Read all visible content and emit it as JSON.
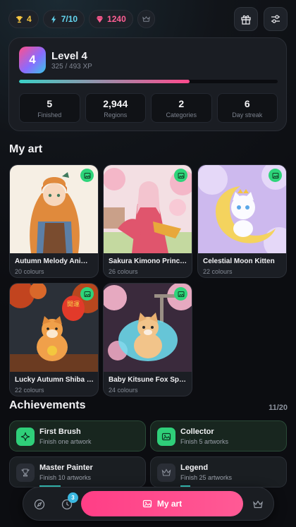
{
  "header": {
    "chips": [
      {
        "icon": "trophy-icon",
        "value": "4"
      },
      {
        "icon": "bolt-icon",
        "value": "7/10"
      },
      {
        "icon": "gem-icon",
        "value": "1240"
      },
      {
        "icon": "crown-icon",
        "value": ""
      }
    ],
    "buttons": [
      {
        "icon": "gift-icon"
      },
      {
        "icon": "sliders-icon"
      }
    ]
  },
  "level": {
    "badge": "4",
    "title": "Level 4",
    "xp": "325 / 493 XP",
    "progress_fraction": 0.66,
    "stats": [
      {
        "value": "5",
        "label": "Finished"
      },
      {
        "value": "2,944",
        "label": "Regions"
      },
      {
        "value": "2",
        "label": "Categories"
      },
      {
        "value": "6",
        "label": "Day streak"
      }
    ]
  },
  "my_art": {
    "title": "My art",
    "items": [
      {
        "name": "Autumn Melody Anime ...",
        "sub": "20 colours"
      },
      {
        "name": "Sakura Kimono Princess",
        "sub": "26 colours"
      },
      {
        "name": "Celestial Moon Kitten",
        "sub": "22 colours"
      },
      {
        "name": "Lucky Autumn Shiba Inu",
        "sub": "22 colours"
      },
      {
        "name": "Baby Kitsune Fox Spirit",
        "sub": "24 colours"
      }
    ],
    "lantern_text": "開運"
  },
  "achievements": {
    "title": "Achievements",
    "count": "11/20",
    "items": [
      {
        "name": "First Brush",
        "desc": "Finish one artwork",
        "icon": "sparkle-icon",
        "done": true
      },
      {
        "name": "Collector",
        "desc": "Finish 5 artworks",
        "icon": "gallery-icon",
        "done": true
      },
      {
        "name": "Master Painter",
        "desc": "Finish 10 artworks",
        "icon": "trophy-icon",
        "done": false,
        "progress": 0.5
      },
      {
        "name": "Legend",
        "desc": "Finish 25 artworks",
        "icon": "crown-icon",
        "done": false,
        "progress": 0.2
      }
    ]
  },
  "nav": {
    "badge": "3",
    "primary_label": "My art"
  },
  "colors": {
    "accent_pink": "#ff4a8d",
    "accent_teal": "#3ad0c6",
    "success_green": "#2fcf79"
  }
}
